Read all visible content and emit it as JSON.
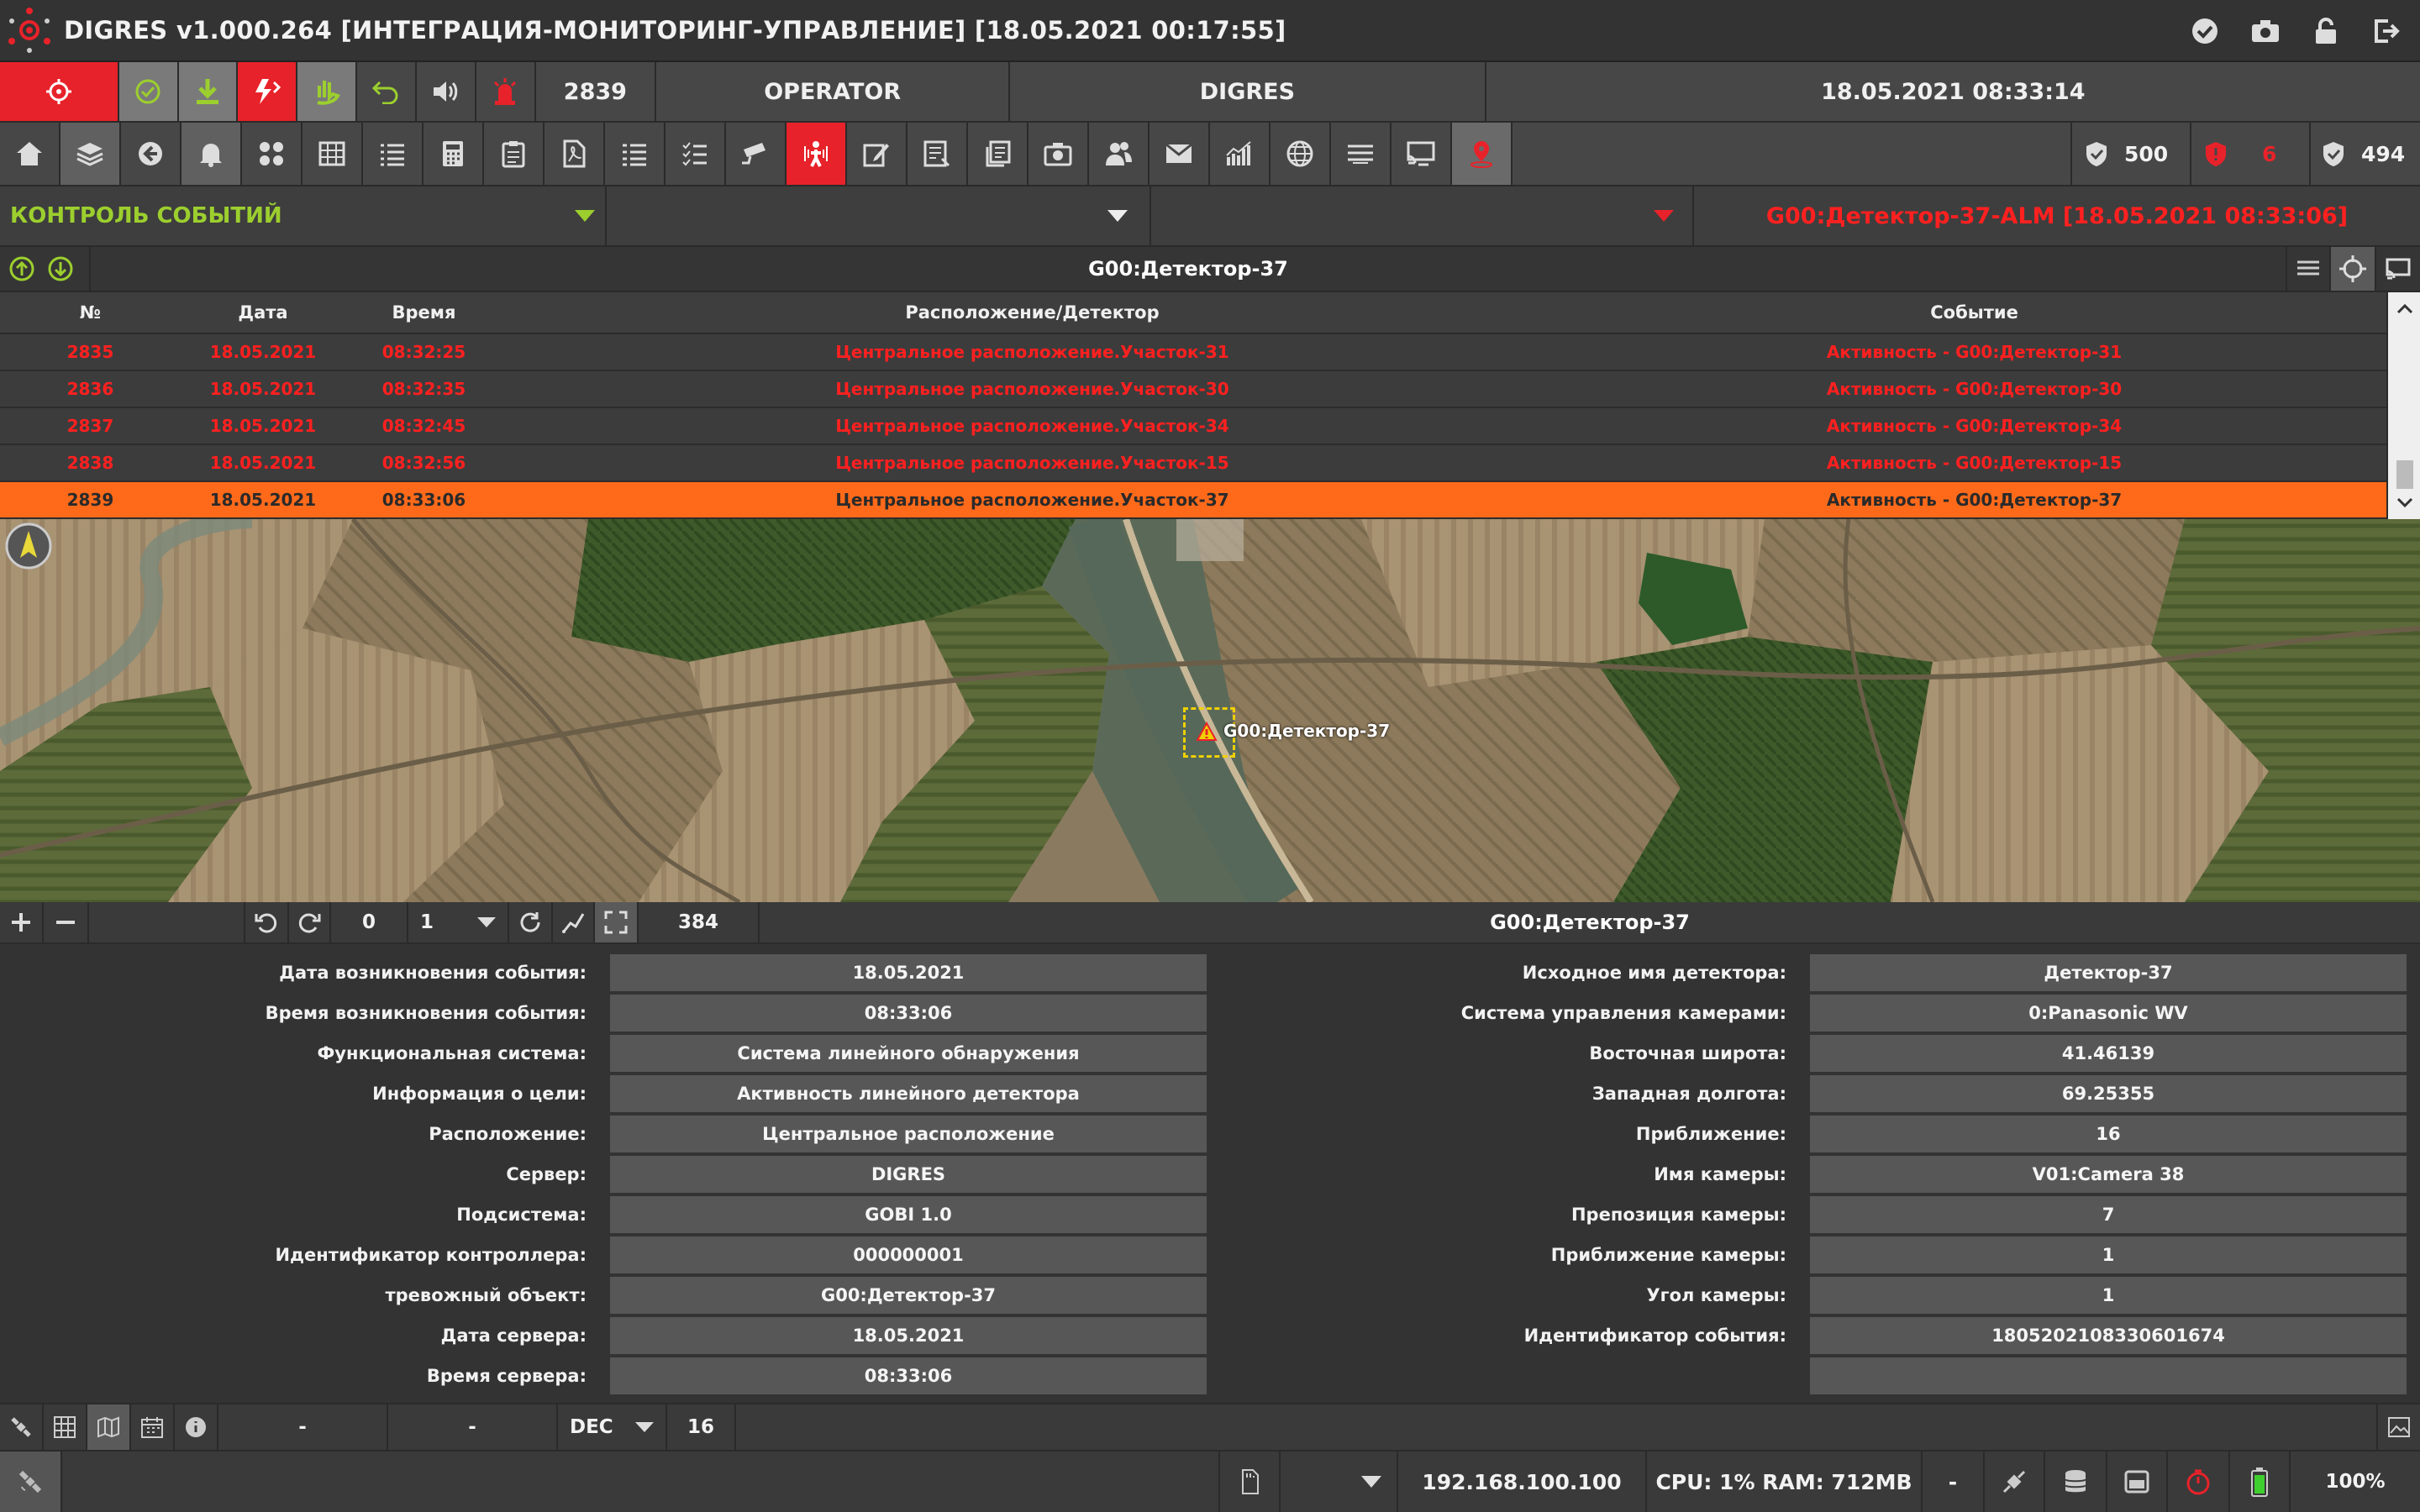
{
  "app": {
    "title": "DIGRES v1.000.264 [ИНТЕГРАЦИЯ-МОНИТОРИНГ-УПРАВЛЕНИЕ] [18.05.2021 00:17:55]"
  },
  "toolbar": {
    "event_count": "2839",
    "user": "OPERATOR",
    "server": "DIGRES",
    "datetime": "18.05.2021 08:33:14"
  },
  "counters": {
    "total": "500",
    "alarms": "6",
    "ok": "494"
  },
  "filter": {
    "mode": "КОНТРОЛЬ СОБЫТИЙ",
    "alarm_text": "G00:Детектор-37-ALM [18.05.2021 08:33:06]"
  },
  "panel": {
    "title": "G00:Детектор-37"
  },
  "table": {
    "headers": [
      "№",
      "Дата",
      "Время",
      "Расположение/Детектор",
      "Событие"
    ],
    "rows": [
      [
        "2835",
        "18.05.2021",
        "08:32:25",
        "Центральное расположение.Участок-31",
        "Активность - G00:Детектор-31"
      ],
      [
        "2836",
        "18.05.2021",
        "08:32:35",
        "Центральное расположение.Участок-30",
        "Активность - G00:Детектор-30"
      ],
      [
        "2837",
        "18.05.2021",
        "08:32:45",
        "Центральное расположение.Участок-34",
        "Активность - G00:Детектор-34"
      ],
      [
        "2838",
        "18.05.2021",
        "08:32:56",
        "Центральное расположение.Участок-15",
        "Активность - G00:Детектор-15"
      ],
      [
        "2839",
        "18.05.2021",
        "08:33:06",
        "Центральное расположение.Участок-37",
        "Активность - G00:Детектор-37"
      ]
    ]
  },
  "map": {
    "marker_label": "G00:Детектор-37",
    "rot_value": "0",
    "zoom_value": "1",
    "scale_value": "384",
    "caption": "G00:Детектор-37"
  },
  "details_left": [
    {
      "label": "Дата возникновения события:",
      "value": "18.05.2021"
    },
    {
      "label": "Время возникновения события:",
      "value": "08:33:06"
    },
    {
      "label": "Функциональная система:",
      "value": "Система линейного обнаружения"
    },
    {
      "label": "Информация о цели:",
      "value": "Активность линейного детектора"
    },
    {
      "label": "Расположение:",
      "value": "Центральное расположение"
    },
    {
      "label": "Сервер:",
      "value": "DIGRES"
    },
    {
      "label": "Подсистема:",
      "value": "GOBI 1.0"
    },
    {
      "label": "Идентификатор контроллера:",
      "value": "000000001"
    },
    {
      "label": "тревожный объект:",
      "value": "G00:Детектор-37"
    },
    {
      "label": "Дата сервера:",
      "value": "18.05.2021"
    },
    {
      "label": "Время сервера:",
      "value": "08:33:06"
    }
  ],
  "details_right": [
    {
      "label": "Исходное имя детектора:",
      "value": "Детектор-37"
    },
    {
      "label": "Система управления камерами:",
      "value": "0:Panasonic WV"
    },
    {
      "label": "Восточная широта:",
      "value": "41.46139"
    },
    {
      "label": "Западная долгота:",
      "value": "69.25355"
    },
    {
      "label": "Приближение:",
      "value": "16"
    },
    {
      "label": "Имя камеры:",
      "value": "V01:Camera 38"
    },
    {
      "label": "Препозиция камеры:",
      "value": "7"
    },
    {
      "label": "Приближение камеры:",
      "value": "1"
    },
    {
      "label": "Угол камеры:",
      "value": "1"
    },
    {
      "label": "Идентификатор события:",
      "value": "1805202108330601674"
    },
    {
      "label": "",
      "value": ""
    }
  ],
  "bottom": {
    "field1": "-",
    "field2": "-",
    "radix": "DEC",
    "radix_value": "16"
  },
  "status": {
    "ip": "192.168.100.100",
    "cpu": "CPU: 1% RAM: 712MB",
    "dash": "-",
    "zoom": "100%"
  },
  "colors": {
    "alarm": "#ff2020",
    "accent_green": "#9ccf2e",
    "selected_row": "#ff6a1a",
    "red_button": "#e8222a"
  }
}
